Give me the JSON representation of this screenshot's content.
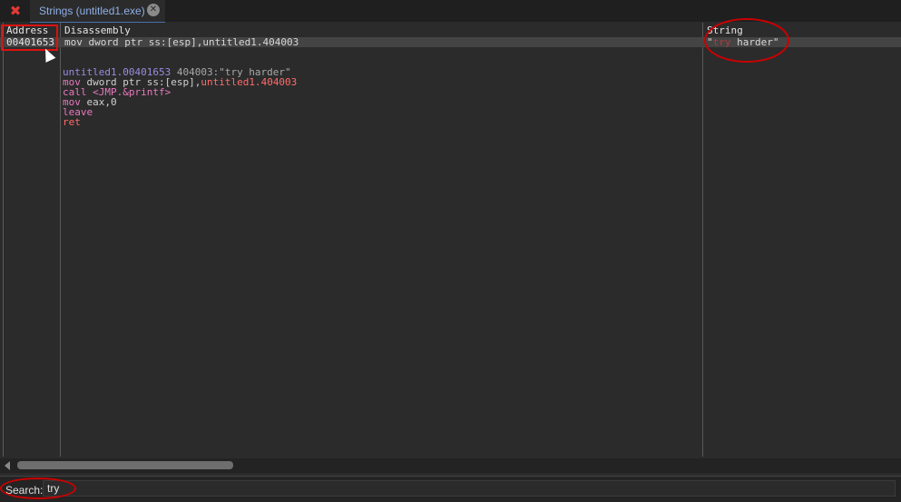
{
  "tab": {
    "label": "Strings (untitled1.exe)"
  },
  "table": {
    "columns": {
      "address": "Address",
      "disassembly": "Disassembly",
      "string": "String"
    },
    "row": {
      "address": "00401653",
      "disassembly": "mov dword ptr ss:[esp],untitled1.404003",
      "string_prefix": "\"",
      "string_match": "try",
      "string_rest": " harder\""
    }
  },
  "code": {
    "label": "untitled1.00401653",
    "comment": " 404003:\"try harder\"",
    "line1_mnem": "mov ",
    "line1_a": "dword ptr ",
    "line1_b": "ss:[esp],",
    "line1_c": "untitled1.404003",
    "line2_mnem": "call ",
    "line2_arg": "<JMP.&printf>",
    "line3_mnem": "mov ",
    "line3_arg": "eax,0",
    "line4": "leave",
    "line5": "ret"
  },
  "search": {
    "label": "Search:",
    "value": "try"
  },
  "colors": {
    "accent": "#4a6fb0",
    "annotation": "#cc0000"
  }
}
